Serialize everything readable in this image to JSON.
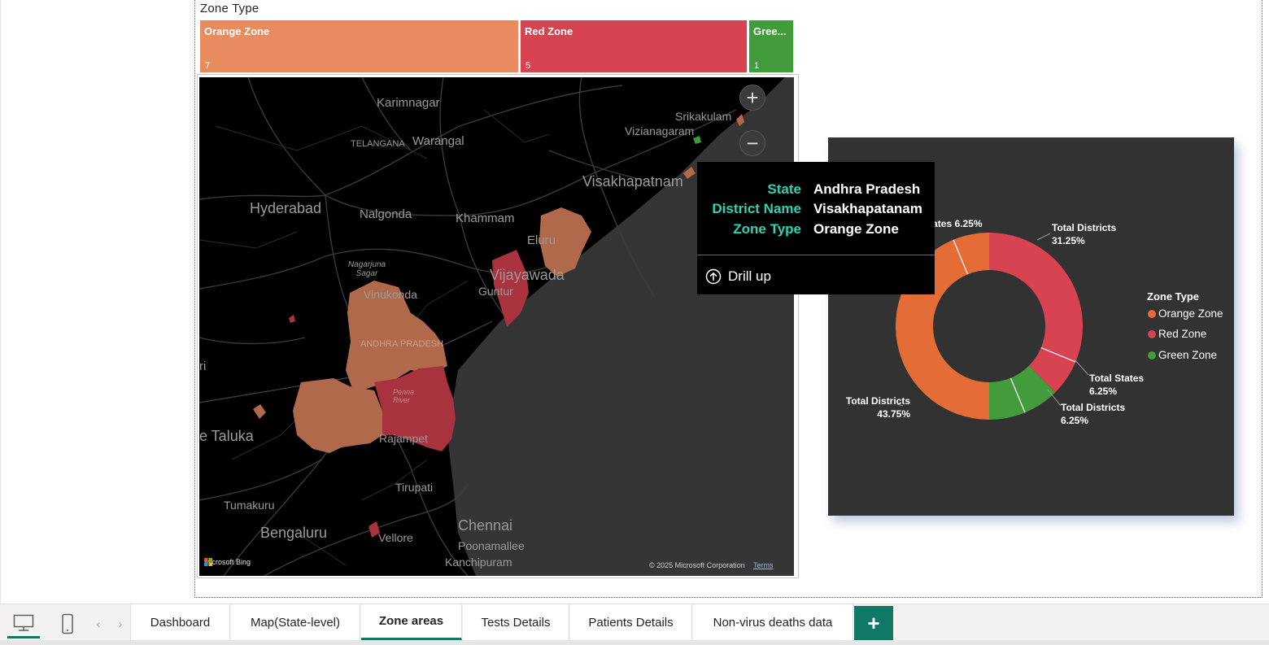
{
  "treemap": {
    "title": "Zone Type",
    "cells": [
      {
        "label": "Orange Zone",
        "value": "7",
        "color": "#e88c5f"
      },
      {
        "label": "Red Zone",
        "value": "5",
        "color": "#d84352"
      },
      {
        "label": "Gree...",
        "value": "1",
        "color": "#429c3b"
      }
    ]
  },
  "map": {
    "labels": {
      "karimnagar": "Karimnagar",
      "srikakulam": "Srikakulam",
      "vizianagaram": "Vizianagaram",
      "telangana": "TELANGANA",
      "warangal": "Warangal",
      "visakhapatnam": "Visakhapatnam",
      "hyderabad": "Hyderabad",
      "nalgonda": "Nalgonda",
      "khammam": "Khammam",
      "eluru": "Eluru",
      "vijayawada": "Vijayawada",
      "nagarjuna_sagar": "Nagarjuna Sagar",
      "guntur": "Guntur",
      "vinukonda": "Vinukonda",
      "andhra_pradesh": "ANDHRA PRADESH",
      "penna_river": "Penna River",
      "taluka": "e Taluka",
      "rajampet": "Rajampet",
      "tirupati": "Tirupati",
      "tumakuru": "Tumakuru",
      "chennai": "Chennai",
      "poonamallee": "Poonamallee",
      "bengaluru": "Bengaluru",
      "vellore": "Vellore",
      "kanchipuram": "Kanchipuram",
      "ri": "ri"
    },
    "bing_logo": "Microsoft Bing",
    "copyright": "© 2025 Microsoft Corporation",
    "terms": "Terms",
    "zoom_in": "+",
    "zoom_out": "−",
    "zone_colors": {
      "orange": "#b06a4b",
      "red": "#a8323d",
      "green": "#3f9a3a"
    }
  },
  "tooltip": {
    "rows": [
      {
        "key": "State",
        "value": "Andhra Pradesh"
      },
      {
        "key": "District Name",
        "value": "Visakhapatanam"
      },
      {
        "key": "Zone Type",
        "value": "Orange Zone"
      }
    ],
    "drill_up": "Drill up",
    "drill_up_icon": "arrow-up-circle-icon"
  },
  "chart_data": {
    "type": "pie",
    "variant": "donut",
    "title": "",
    "legend": {
      "title": "Zone Type",
      "placement": "right",
      "entries": [
        "Orange Zone",
        "Red Zone",
        "Green Zone"
      ]
    },
    "series_colors": {
      "Orange Zone": "#e46c37",
      "Red Zone": "#d84352",
      "Green Zone": "#429c3b"
    },
    "slices": [
      {
        "label": "Total Districts",
        "zone": "Red Zone",
        "value": 31.25,
        "text": "31.25%"
      },
      {
        "label": "Total States",
        "zone": "Red Zone",
        "value": 6.25,
        "text": "6.25%"
      },
      {
        "label": "Total Districts",
        "zone": "Green Zone",
        "value": 6.25,
        "text": "6.25%"
      },
      {
        "label": "Total States",
        "zone": "Green Zone",
        "value": 6.25,
        "text": "6.25%"
      },
      {
        "label": "Total Districts",
        "zone": "Orange Zone",
        "value": 43.75,
        "text": "43.75%"
      },
      {
        "label": "Total States",
        "zone": "Orange Zone",
        "value": 6.25,
        "text": "6.25%"
      }
    ]
  },
  "bottom_bar": {
    "desktop_icon": "desktop-monitor-icon",
    "mobile_icon": "mobile-phone-icon",
    "prev_arrow": "‹",
    "next_arrow": "›",
    "tabs": [
      "Dashboard",
      "Map(State-level)",
      "Zone areas",
      "Tests Details",
      "Patients Details",
      "Non-virus deaths data"
    ],
    "active_tab": "Zone areas",
    "add_label": "+"
  }
}
